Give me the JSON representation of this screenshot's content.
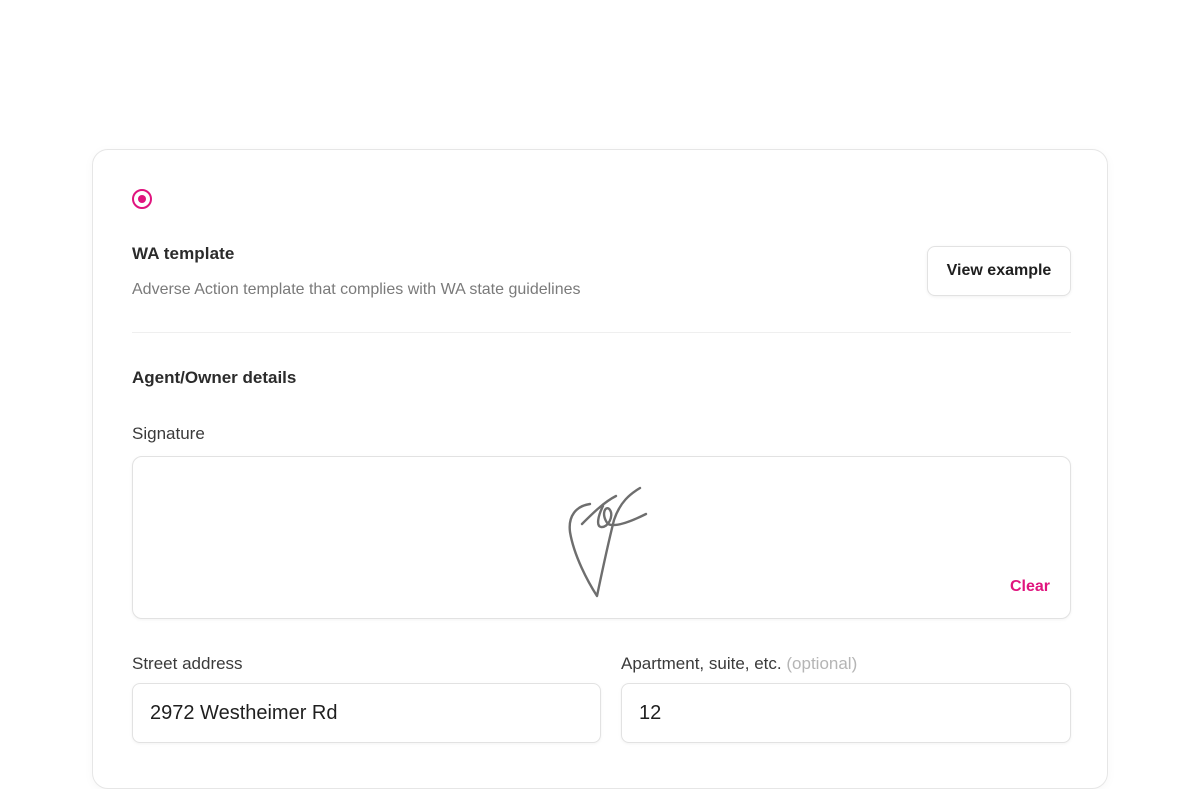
{
  "template": {
    "title": "WA template",
    "description": "Adverse Action template that complies with WA state guidelines",
    "view_example_label": "View example",
    "accent_color": "#e0147e"
  },
  "section": {
    "title": "Agent/Owner details"
  },
  "signature": {
    "label": "Signature",
    "clear_label": "Clear"
  },
  "address": {
    "street_label": "Street address",
    "street_value": "2972 Westheimer Rd",
    "apartment_label": "Apartment, suite, etc.",
    "apartment_optional": "(optional)",
    "apartment_value": "12"
  }
}
